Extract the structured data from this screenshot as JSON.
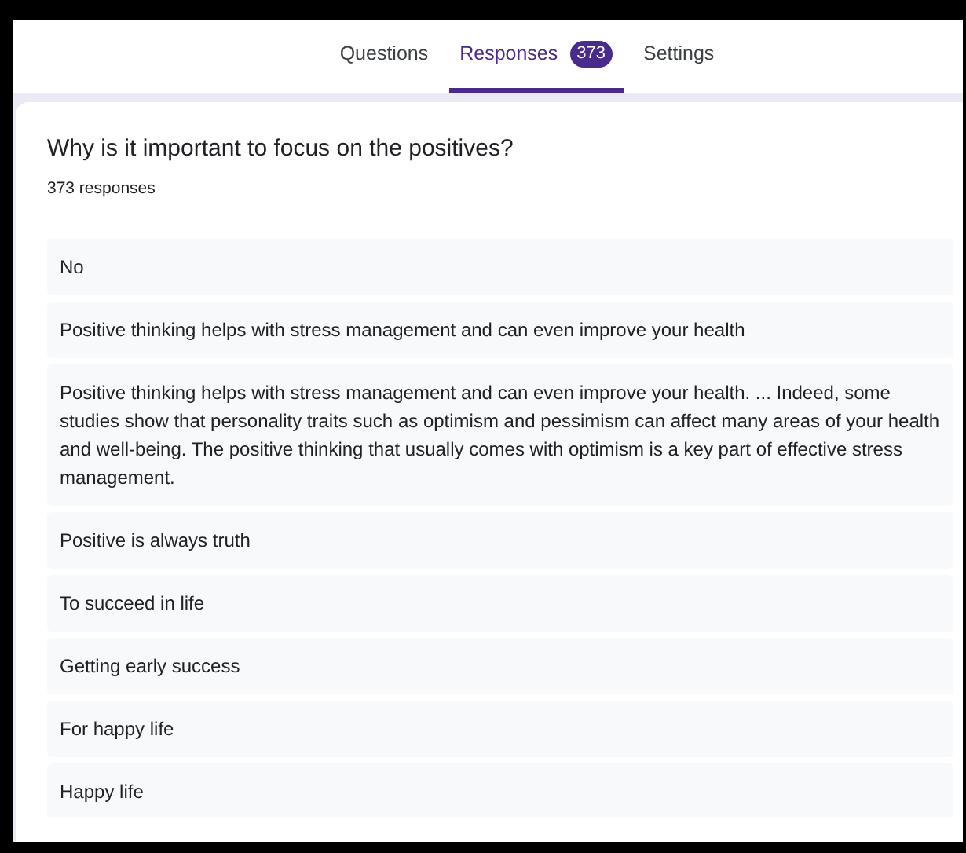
{
  "tabs": [
    {
      "label": "Questions",
      "selected": false
    },
    {
      "label": "Responses",
      "selected": true,
      "badge": "373"
    },
    {
      "label": "Settings",
      "selected": false
    }
  ],
  "question": {
    "title": "Why is it important to focus on the positives?",
    "count": "373 responses"
  },
  "responses": [
    "No",
    "Positive thinking helps with stress management and can even improve your health",
    "Positive thinking helps with stress management and can even improve your health. ... Indeed, some studies show that personality traits such as optimism and pessimism can affect many areas of your health and well-being. The positive thinking that usually comes with optimism is a key part of effective stress management.",
    "Positive is always truth",
    "To succeed in life",
    "Getting early success",
    "For happy life",
    "Happy life"
  ]
}
